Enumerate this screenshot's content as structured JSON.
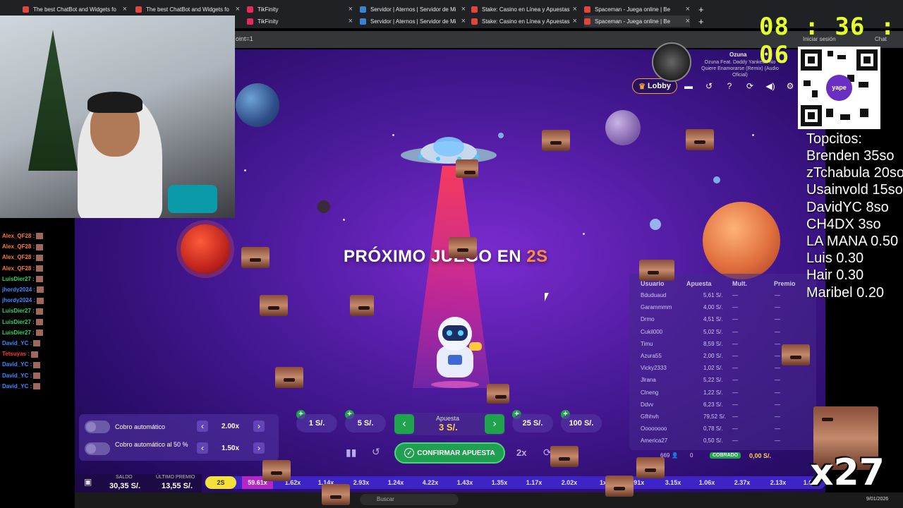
{
  "browser": {
    "tabs_row1": [
      "The best ChatBot and Widgets fo",
      "The best ChatBot and Widgets fo",
      "TikFinity",
      "Servidor | Aternos | Servidor de Mi",
      "Stake: Casino en Línea y Apuestas",
      "Spaceman - Juega online | Be"
    ],
    "tabs_row2": [
      "TikFinity",
      "Servidor | Aternos | Servidor de Mi",
      "Stake: Casino en Línea y Apuestas",
      "Spaceman - Juega online | Be"
    ],
    "url": "oint=1",
    "signin": "Iniciar sesión",
    "chat_label": "Chat"
  },
  "clock": {
    "h": "08",
    "m": "36",
    "s": "06",
    "sep": ":"
  },
  "song": {
    "artist": "Ozuna",
    "title": "Ozuna Feat. Daddy Yankee - No Quiere Enamorarse (Remix) (Audio Oficial)"
  },
  "qr": {
    "brand": "yape"
  },
  "top_donors": {
    "title": "Topcitos:",
    "entries": [
      "Brenden 35so",
      "zTchabula 20so",
      "Usainvold 15so",
      "DavidYC 8so",
      "CH4DX 3so",
      "LA MANA 0.50",
      "Luis 0.30",
      "Hair 0.30",
      "Maribel 0.20"
    ]
  },
  "game": {
    "lobby_label": "Lobby",
    "next_round_prefix": "PRÓXIMO JUEGO EN ",
    "countdown": "2S",
    "bets_headers": {
      "user": "Usuario",
      "bet": "Apuesta",
      "mult": "Mult.",
      "prize": "Premio"
    },
    "bets": [
      {
        "user": "Bduduaud",
        "bet": "5,61 S/.",
        "mult": "—",
        "prize": "—"
      },
      {
        "user": "Garammmm",
        "bet": "4,00 S/.",
        "mult": "—",
        "prize": "—"
      },
      {
        "user": "Drmo",
        "bet": "4,51 S/.",
        "mult": "—",
        "prize": "—"
      },
      {
        "user": "Cukil000",
        "bet": "5,02 S/.",
        "mult": "—",
        "prize": "—"
      },
      {
        "user": "Timu",
        "bet": "8,59 S/.",
        "mult": "—",
        "prize": "—"
      },
      {
        "user": "Azura55",
        "bet": "2,00 S/.",
        "mult": "—",
        "prize": "—"
      },
      {
        "user": "Vicky2333",
        "bet": "1,02 S/.",
        "mult": "—",
        "prize": "—"
      },
      {
        "user": "Jlrana",
        "bet": "5,22 S/.",
        "mult": "—",
        "prize": "—"
      },
      {
        "user": "Clneng",
        "bet": "1,22 S/.",
        "mult": "—",
        "prize": "—"
      },
      {
        "user": "Ddvv",
        "bet": "6,23 S/.",
        "mult": "—",
        "prize": "—"
      },
      {
        "user": "Gfhhvh",
        "bet": "79,52 S/.",
        "mult": "—",
        "prize": "—"
      },
      {
        "user": "Oooooooo",
        "bet": "0,78 S/.",
        "mult": "—",
        "prize": "—"
      },
      {
        "user": "America27",
        "bet": "0,50 S/.",
        "mult": "—",
        "prize": "—"
      }
    ],
    "bets_footer": {
      "players": "669",
      "cashed": "0",
      "cobrado_label": "COBRADO",
      "total": "0,00 S/."
    },
    "auto_cashout": {
      "label1": "Cobro automático",
      "value1": "2.00x",
      "label2": "Cobro automático al 50 %",
      "value2": "1.50x"
    },
    "chips": [
      "1 S/.",
      "5 S/.",
      "25 S/.",
      "100 S/."
    ],
    "stake": {
      "label": "Apuesta",
      "value": "3 S/."
    },
    "confirm_label": "CONFIRMAR APUESTA",
    "twox_label": "2x",
    "balance": {
      "saldo_label": "SALDO",
      "saldo": "30,35 S/.",
      "premio_label": "ÚLTIMO PREMIO",
      "premio": "13,55 S/."
    },
    "multipliers": [
      "2S",
      "59.61x",
      "1.62x",
      "1.14x",
      "2.93x",
      "1.24x",
      "4.22x",
      "1.43x",
      "1.35x",
      "1.17x",
      "2.02x",
      "1x",
      "1.91x",
      "3.15x",
      "1.06x",
      "2.37x",
      "2.13x",
      "1.0"
    ]
  },
  "chat": {
    "lines": [
      {
        "user": "Alex_QF28 :",
        "color": "#ff7a2a"
      },
      {
        "user": "Alex_QF28 :",
        "color": "#ff7a2a"
      },
      {
        "user": "Alex_QF28 :",
        "color": "#ff7a2a"
      },
      {
        "user": "Alex_QF28 :",
        "color": "#ff7a2a"
      },
      {
        "user": "LuisDier27 :",
        "color": "#2ad66a"
      },
      {
        "user": "jhordy2024 :",
        "color": "#3a8cff"
      },
      {
        "user": "jhordy2024 :",
        "color": "#3a8cff"
      },
      {
        "user": "LuisDier27 :",
        "color": "#2ad66a"
      },
      {
        "user": "LuisDier27 :",
        "color": "#2ad66a"
      },
      {
        "user": "LuisDier27 :",
        "color": "#2ad66a"
      },
      {
        "user": "David_YC :",
        "color": "#3a8cff"
      },
      {
        "user": "Tetsuyas :",
        "color": "#ff3a3a"
      },
      {
        "user": "David_YC :",
        "color": "#3a8cff"
      },
      {
        "user": "David_YC :",
        "color": "#3a8cff"
      },
      {
        "user": "David_YC :",
        "color": "#3a8cff"
      }
    ]
  },
  "overlay": {
    "combo": "x27"
  },
  "taskbar": {
    "search": "Buscar",
    "date": "9/01/2026"
  }
}
